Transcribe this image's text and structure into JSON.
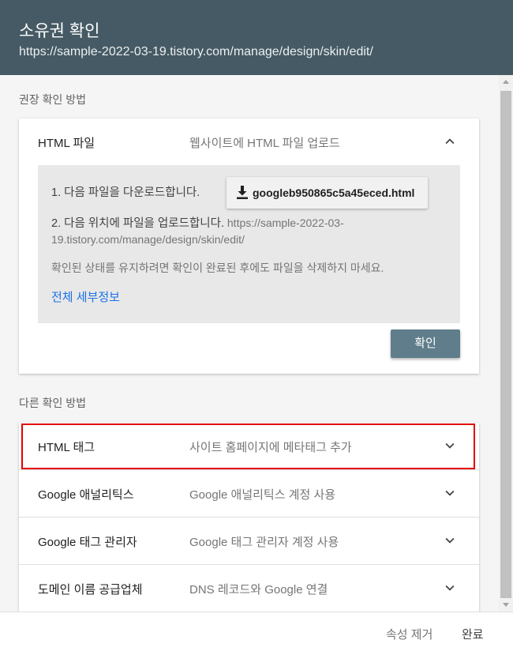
{
  "header": {
    "title": "소유권 확인",
    "url": "https://sample-2022-03-19.tistory.com/manage/design/skin/edit/"
  },
  "recommended": {
    "label": "권장 확인 방법",
    "method": {
      "name": "HTML 파일",
      "desc": "웹사이트에 HTML 파일 업로드",
      "step1": "1. 다음 파일을 다운로드합니다.",
      "download_label": "googleb950865c5a45eced.html",
      "step2_text": "2. 다음 위치에 파일을 업로드합니다.",
      "step2_url_line1": "https://sample-2022-03-",
      "step2_url_line2": "19.tistory.com/manage/design/skin/edit/",
      "note": "확인된 상태를 유지하려면 확인이 완료된 후에도 파일을 삭제하지 마세요.",
      "details_link": "전체 세부정보",
      "confirm_label": "확인"
    }
  },
  "other": {
    "label": "다른 확인 방법",
    "methods": [
      {
        "name": "HTML 태그",
        "desc": "사이트 홈페이지에 메타태그 추가"
      },
      {
        "name": "Google 애널리틱스",
        "desc": "Google 애널리틱스 계정 사용"
      },
      {
        "name": "Google 태그 관리자",
        "desc": "Google 태그 관리자 계정 사용"
      },
      {
        "name": "도메인 이름 공급업체",
        "desc": "DNS 레코드와 Google 연결"
      }
    ]
  },
  "footer": {
    "remove_label": "속성 제거",
    "done_label": "완료"
  },
  "colors": {
    "header_bg": "#455a64",
    "confirm_bg": "#607d8b",
    "link": "#1a73e8",
    "highlight": "#e50000"
  }
}
